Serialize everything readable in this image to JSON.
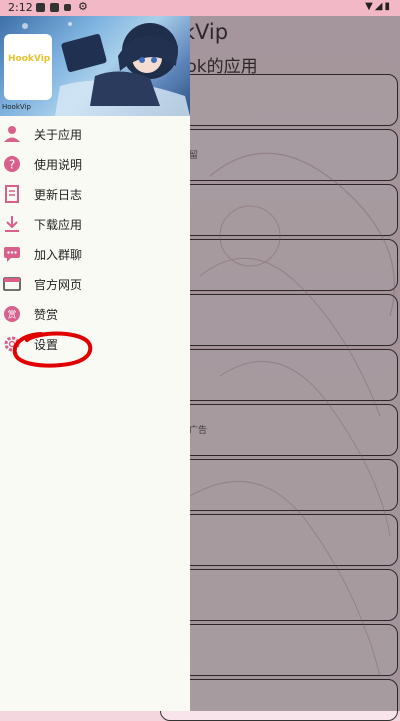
{
  "status_bar": {
    "time": "2:12"
  },
  "background_app": {
    "title": "okVip",
    "subtitle": "ook的应用",
    "card_fragments": [
      "留",
      "广告"
    ]
  },
  "drawer": {
    "banner": {
      "logo_text": "HookVip",
      "caption": "HookVip"
    },
    "menu": [
      {
        "label": "关于应用",
        "icon": "user-icon"
      },
      {
        "label": "使用说明",
        "icon": "help-icon"
      },
      {
        "label": "更新日志",
        "icon": "log-icon"
      },
      {
        "label": "下载应用",
        "icon": "download-icon"
      },
      {
        "label": "加入群聊",
        "icon": "chat-icon"
      },
      {
        "label": "官方网页",
        "icon": "browser-icon"
      },
      {
        "label": "赞赏",
        "icon": "reward-icon"
      },
      {
        "label": "设置",
        "icon": "gear-icon"
      }
    ]
  },
  "colors": {
    "accent": "#d9608a",
    "status_bar": "#f2b8c6",
    "highlight": "#e00000"
  }
}
